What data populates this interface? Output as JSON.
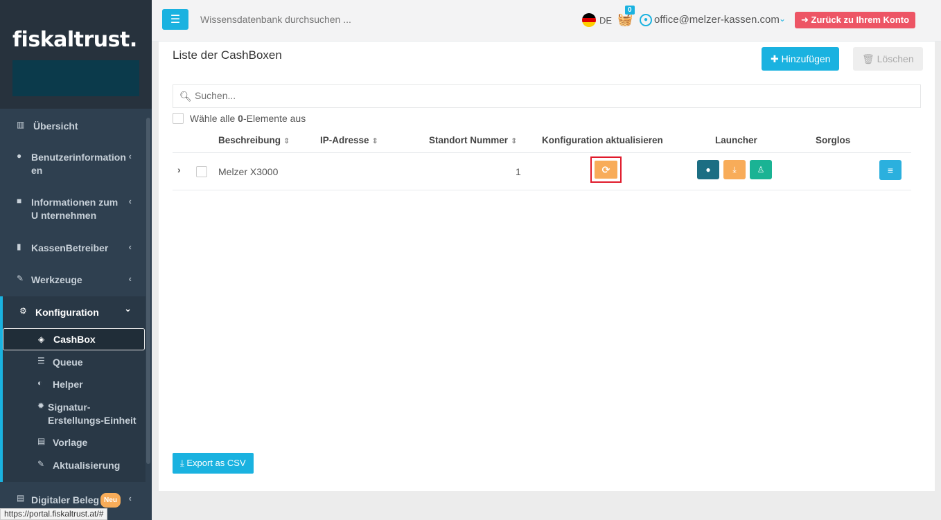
{
  "sidebar": {
    "logo": "fiskaltrust.",
    "items": [
      {
        "label": "Übersicht",
        "icon": "bar-chart-icon",
        "chevron": ""
      },
      {
        "label": "Benutzerinformation en",
        "icon": "user-circle-icon",
        "chevron": "‹"
      },
      {
        "label": "Informationen zum U nternehmen",
        "icon": "briefcase-icon",
        "chevron": "‹"
      },
      {
        "label": "KassenBetreiber",
        "icon": "building-icon",
        "chevron": "‹"
      },
      {
        "label": "Werkzeuge",
        "icon": "wrench-icon",
        "chevron": "‹"
      },
      {
        "label": "Konfiguration",
        "icon": "cogs-icon",
        "chevron": "⌄"
      }
    ],
    "sub_items": [
      {
        "label": "CashBox",
        "icon": "cube-icon"
      },
      {
        "label": "Queue",
        "icon": "database-icon"
      },
      {
        "label": "Helper",
        "icon": "adjust-icon"
      },
      {
        "label": "Signatur-Erstellungs-Einheit",
        "icon": "certificate-icon"
      },
      {
        "label": "Vorlage",
        "icon": "file-icon"
      },
      {
        "label": "Aktualisierung",
        "icon": "wrench-icon"
      }
    ],
    "last_item": {
      "label": "Digitaler Beleg",
      "badge": "Neu",
      "chevron": "‹"
    }
  },
  "topbar": {
    "search_placeholder": "Wissensdatenbank durchsuchen ...",
    "lang": "DE",
    "cart_count": "0",
    "user_email": "office@melzer-kassen.com",
    "back_button": "Zurück zu Ihrem Konto"
  },
  "main": {
    "title": "Liste der CashBoxen",
    "add_button": "Hinzufügen",
    "delete_button": "Löschen",
    "search_placeholder": "Suchen...",
    "select_all_prefix": "Wähle alle ",
    "select_all_count": "0",
    "select_all_suffix": "-Elemente aus",
    "columns": [
      "Beschreibung",
      "IP-Adresse",
      "Standort Nummer",
      "Konfiguration aktualisieren",
      "Launcher",
      "Sorglos"
    ],
    "rows": [
      {
        "beschreibung": "Melzer X3000",
        "ip": "",
        "standort": "1"
      }
    ],
    "export_button": "Export as CSV"
  },
  "status_bar": {
    "url": "https://portal.fiskaltrust.at/#"
  },
  "colors": {
    "accent": "#1ab2e0",
    "warning": "#f8ac59",
    "danger": "#ed5565",
    "dark_teal": "#1c6e83",
    "green": "#1ab394",
    "sidebar": "#2f4050"
  }
}
